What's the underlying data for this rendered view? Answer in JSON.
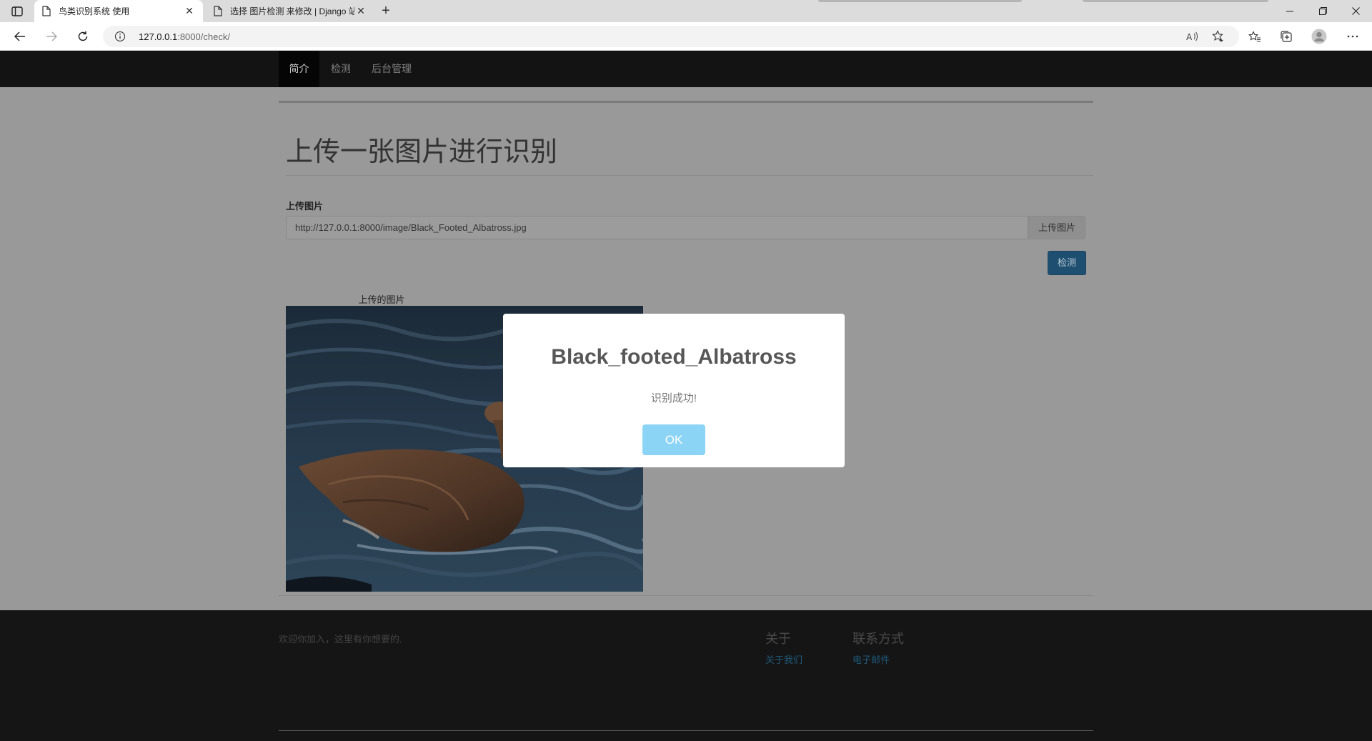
{
  "browser": {
    "tabs": [
      {
        "title": "鸟类识别系统 使用",
        "active": true
      },
      {
        "title": "选择 图片检测 来修改 | Django 站",
        "active": false
      }
    ],
    "url_host": "127.0.0.1",
    "url_rest": ":8000/check/"
  },
  "nav": {
    "items": [
      {
        "label": "简介"
      },
      {
        "label": "检测"
      },
      {
        "label": "后台管理"
      }
    ]
  },
  "main": {
    "heading": "上传一张图片进行识别",
    "upload_label": "上传图片",
    "image_url_value": "http://127.0.0.1:8000/image/Black_Footed_Albatross.jpg",
    "upload_button": "上传图片",
    "detect_button": "检测",
    "image_caption": "上传的图片"
  },
  "footer": {
    "welcome": "欢迎你加入，这里有你想要的.",
    "about_heading": "关于",
    "about_link": "关于我们",
    "contact_heading": "联系方式",
    "contact_link": "电子邮件"
  },
  "modal": {
    "title": "Black_footed_Albatross",
    "message": "识别成功!",
    "ok_button": "OK"
  },
  "colors": {
    "overlay_bg": "#999999",
    "nav_bg": "#131313",
    "ok_button": "#8cd4f5",
    "detect_button": "#1f4f70"
  }
}
